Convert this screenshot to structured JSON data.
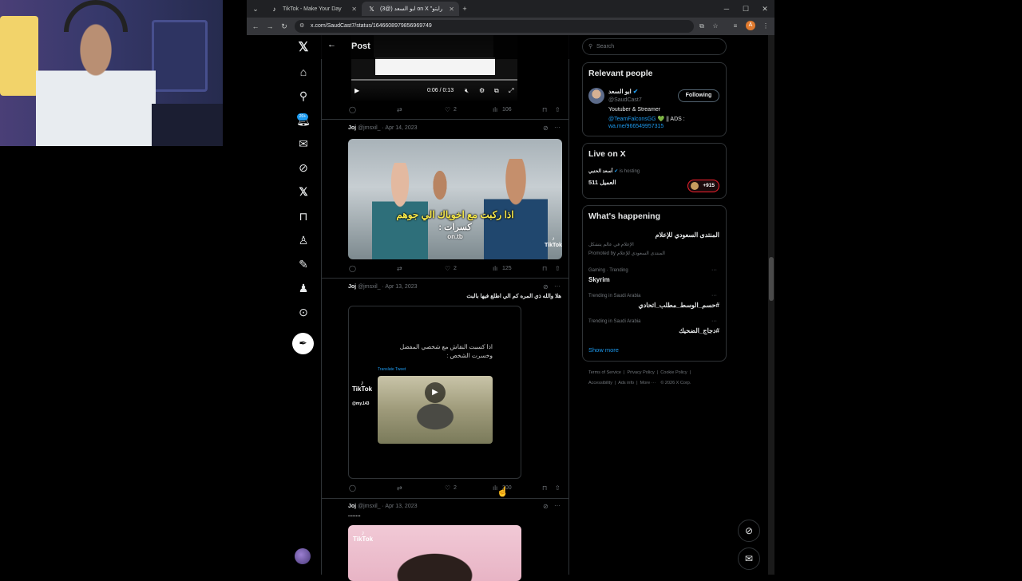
{
  "browser": {
    "tabs": [
      {
        "title": "TikTok - Make Your Day",
        "icon": "tiktok-icon",
        "active": false
      },
      {
        "title": "ابو السعد (@3) on X \"رايتو",
        "icon": "x-logo-icon",
        "active": true
      }
    ],
    "url": "x.com/SaudCast7/status/1646608979856969749",
    "profile_initial": "A"
  },
  "header": {
    "title": "Post"
  },
  "video": {
    "time": "0:06 / 0:13"
  },
  "tweets": [
    {
      "actions": {
        "replies": "",
        "retweets": "",
        "likes": "2",
        "views": "106"
      }
    },
    {
      "name": "Joj",
      "handle": "@jmsxil_",
      "date": "· Apr 14, 2023",
      "media": {
        "caption_yellow": "اذا ركبت مع اخوياك الي جوهم",
        "caption_white": "كسرات :",
        "caption_small": "on.tb"
      },
      "actions": {
        "likes": "2",
        "views": "125"
      }
    },
    {
      "name": "Joj",
      "handle": "@jmsxil_",
      "date": "· Apr 13, 2023",
      "text": "هلا والله ذي المره كم الي اطلع فيها بالبث",
      "media": {
        "text_line1": "اذا كسبت النقاش مع شخصي المفضل",
        "text_line2": "وخسرت الشخص :",
        "translate": "Translate Tweet",
        "tiktok_user": "@my.143"
      },
      "actions": {
        "likes": "2",
        "views": "200"
      }
    },
    {
      "name": "Joj",
      "handle": "@jmsxil_",
      "date": "· Apr 13, 2023",
      "text": "........"
    }
  ],
  "search": {
    "placeholder": "Search"
  },
  "relevant": {
    "title": "Relevant people",
    "name": "ابو السعد",
    "handle": "@SaudCast7",
    "follow_label": "Following",
    "bio_line1": "Youtuber & Streamer",
    "bio_link1": "@TeamFalconsGG",
    "bio_mid": "💚 || ADS :",
    "bio_link2": "wa.me/966549957315"
  },
  "live": {
    "title": "Live on X",
    "host_name": "أسعد الحنبي",
    "host_suffix": "is hosting",
    "stream_title": "العميل 511",
    "count": "+915"
  },
  "happening": {
    "title": "What's happening",
    "promo_title": "المنتدى السعودي للإعلام",
    "promo_sub": "الإعلام في عالم يتشكل",
    "promo_by": "Promoted by المنتدى السعودي للإعلام",
    "trends": [
      {
        "meta": "Gaming · Trending",
        "name": "Skyrim"
      },
      {
        "meta": "Trending in Saudi Arabia",
        "name": "#حسم_الوسط_مطلب_اتحادي"
      },
      {
        "meta": "Trending in Saudi Arabia",
        "name": "#دجاج_الضحيك"
      }
    ],
    "show_more": "Show more"
  },
  "footer": {
    "terms": "Terms of Service",
    "privacy": "Privacy Policy",
    "cookie": "Cookie Policy",
    "accessibility": "Accessibility",
    "ads": "Ads info",
    "more": "More ···",
    "copyright": "© 2026 X Corp."
  },
  "colors": {
    "accent": "#1d9bf0",
    "background": "#000000",
    "live_red": "#f4212e"
  }
}
